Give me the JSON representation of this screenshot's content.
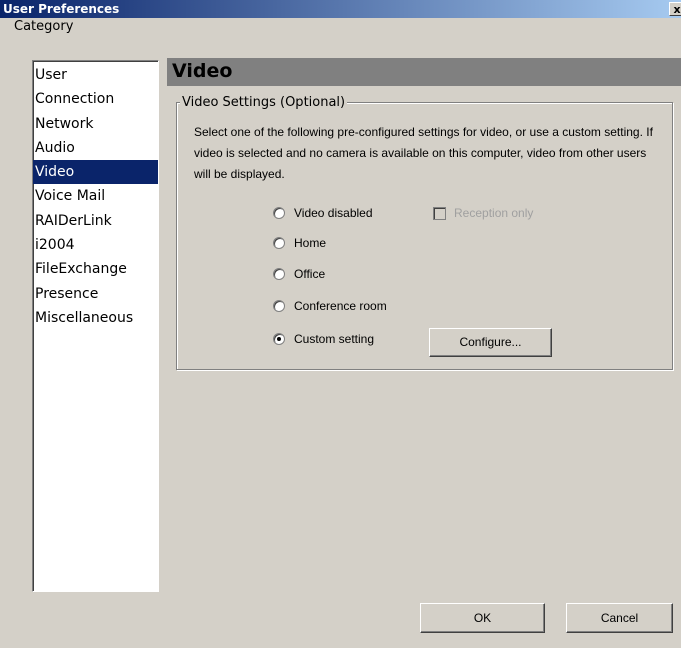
{
  "window": {
    "title": "User Preferences",
    "close_label": "x"
  },
  "category": {
    "label": "Category",
    "items": [
      {
        "label": "User",
        "selected": false
      },
      {
        "label": "Connection",
        "selected": false
      },
      {
        "label": "Network",
        "selected": false
      },
      {
        "label": "Audio",
        "selected": false
      },
      {
        "label": "Video",
        "selected": true
      },
      {
        "label": "Voice Mail",
        "selected": false
      },
      {
        "label": "RAIDerLink",
        "selected": false
      },
      {
        "label": "i2004",
        "selected": false
      },
      {
        "label": "FileExchange",
        "selected": false
      },
      {
        "label": "Presence",
        "selected": false
      },
      {
        "label": "Miscellaneous",
        "selected": false
      }
    ]
  },
  "section": {
    "title": "Video",
    "group_title": "Video Settings (Optional)",
    "description": "Select one of the following pre-configured settings for video, or use a custom setting. If video is selected and no camera is available on this computer, video from other users will be displayed."
  },
  "options": [
    {
      "label": "Video disabled",
      "checked": false
    },
    {
      "label": "Home",
      "checked": false
    },
    {
      "label": "Office",
      "checked": false
    },
    {
      "label": "Conference room",
      "checked": false
    },
    {
      "label": "Custom setting",
      "checked": true
    }
  ],
  "reception_only": {
    "label": "Reception only",
    "checked": false,
    "enabled": false
  },
  "buttons": {
    "configure": "Configure...",
    "ok": "OK",
    "cancel": "Cancel"
  }
}
